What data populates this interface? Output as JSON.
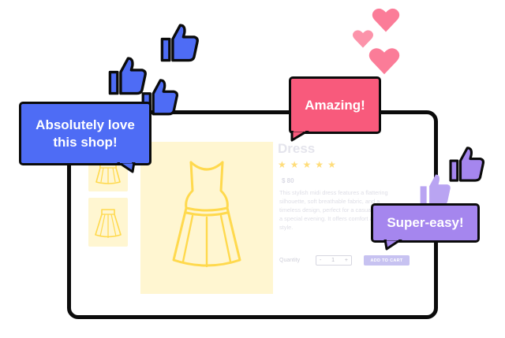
{
  "product": {
    "title": "Dress",
    "rating_stars": 5,
    "price": "$ 80",
    "description": "This stylish midi dress features a flattering silhouette, soft breathable fabric, and a timeless design, perfect for a casual day out or a special evening. It offers comfort and elegant style.",
    "quantity_label": "Quantity",
    "quantity_value": "1",
    "quantity_minus": "-",
    "quantity_plus": "+",
    "add_to_cart_label": "ADD TO CART"
  },
  "reviews": {
    "blue": "Absolutely love this shop!",
    "pink": "Amazing!",
    "purple": "Super-easy!"
  },
  "colors": {
    "blue": "#4e6cf5",
    "pink": "#f85a7c",
    "purple": "#a586ee",
    "dress_outline": "#ffd94d",
    "image_bg": "#fff6d1",
    "heart": "#fb7c98"
  },
  "icons": [
    "thumbs-up-icon",
    "heart-icon",
    "star-icon",
    "dress-icon",
    "skirt-icon"
  ]
}
